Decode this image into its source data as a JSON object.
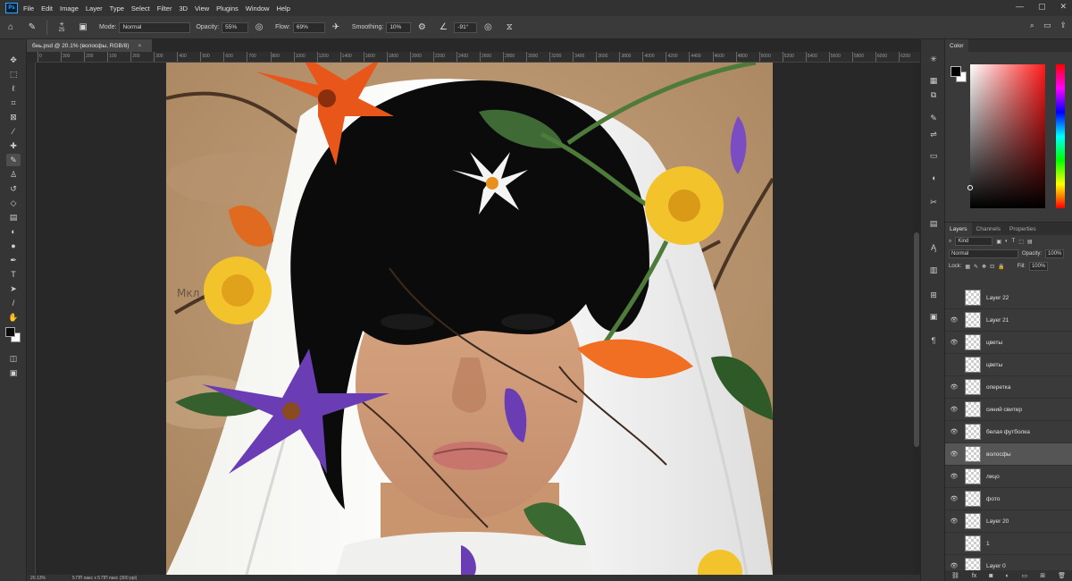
{
  "app": {
    "logo": "Ps"
  },
  "menu": [
    "File",
    "Edit",
    "Image",
    "Layer",
    "Type",
    "Select",
    "Filter",
    "3D",
    "View",
    "Plugins",
    "Window",
    "Help"
  ],
  "window_controls": [
    "—",
    "▢",
    "✕"
  ],
  "options": {
    "brush_size": "25",
    "mode_label": "Mode:",
    "mode_value": "Normal",
    "opacity_label": "Opacity:",
    "opacity_value": "55%",
    "flow_label": "Flow:",
    "flow_value": "69%",
    "smoothing_label": "Smoothing:",
    "smoothing_value": "10%",
    "angle_value": "-91°"
  },
  "document": {
    "tab_title": "бнь.psd @ 20.1% (волосфы, RGB/8)",
    "zoom": "20.13%",
    "doc_size": "5 ПП пакс x 5 ПП пакс (300 ppi)"
  },
  "ruler_ticks": [
    "0",
    "300",
    "200",
    "100",
    "200",
    "300",
    "400",
    "500",
    "600",
    "700",
    "800",
    "1000",
    "1200",
    "1400",
    "1600",
    "1800",
    "2000",
    "2200",
    "2400",
    "2600",
    "2800",
    "3000",
    "3200",
    "3400",
    "3600",
    "3800",
    "4000",
    "4200",
    "4400",
    "4600",
    "4800",
    "5000",
    "5200",
    "5400",
    "5600",
    "5800",
    "6000",
    "6200"
  ],
  "tools": [
    "move",
    "marquee",
    "lasso",
    "crop",
    "frame",
    "eyedropper",
    "healing",
    "brush",
    "stamp",
    "history",
    "eraser",
    "gradient",
    "blur",
    "dodge",
    "pen",
    "type",
    "path-select",
    "shape",
    "hand",
    "zoom",
    "more"
  ],
  "color_panel": {
    "title": "Color",
    "fg": "#000000",
    "bg": "#ffffff"
  },
  "layers_panel": {
    "tabs": [
      "Layers",
      "Channels",
      "Properties"
    ],
    "filter_label": "Kind",
    "blend_mode": "Normal",
    "opacity_label": "Opacity:",
    "opacity_value": "100%",
    "lock_label": "Lock:",
    "fill_label": "Fill:",
    "fill_value": "100%",
    "layers": [
      {
        "name": "Layer 22",
        "visible": false,
        "selected": false
      },
      {
        "name": "Layer 21",
        "visible": true,
        "selected": false
      },
      {
        "name": "цветы",
        "visible": true,
        "selected": false
      },
      {
        "name": "цветы",
        "visible": false,
        "selected": false
      },
      {
        "name": "оперетка",
        "visible": true,
        "selected": false
      },
      {
        "name": "синий свитер",
        "visible": true,
        "selected": false
      },
      {
        "name": "белая футболка",
        "visible": true,
        "selected": false
      },
      {
        "name": "волосфы",
        "visible": true,
        "selected": true
      },
      {
        "name": "лицо",
        "visible": true,
        "selected": false
      },
      {
        "name": "фото",
        "visible": true,
        "selected": false
      },
      {
        "name": "Layer 20",
        "visible": true,
        "selected": false
      },
      {
        "name": "1",
        "visible": false,
        "selected": false
      },
      {
        "name": "Layer 0",
        "visible": true,
        "selected": false
      }
    ]
  },
  "artwork": {
    "description_visible_signature": "Мкл"
  }
}
